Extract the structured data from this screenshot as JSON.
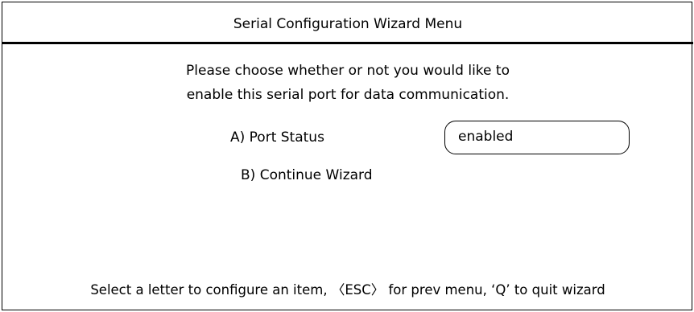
{
  "header": {
    "title": "Serial Configuration Wizard Menu"
  },
  "prompt": {
    "line1": "Please choose whether or not you would like to",
    "line2": "enable this serial port for data communication."
  },
  "options": [
    {
      "label": "A) Port Status",
      "value": "enabled"
    },
    {
      "label": "B) Continue Wizard"
    }
  ],
  "footer": {
    "help": "Select a letter to configure an item, 〈ESC〉 for prev menu, ‘Q’ to quit wizard"
  }
}
